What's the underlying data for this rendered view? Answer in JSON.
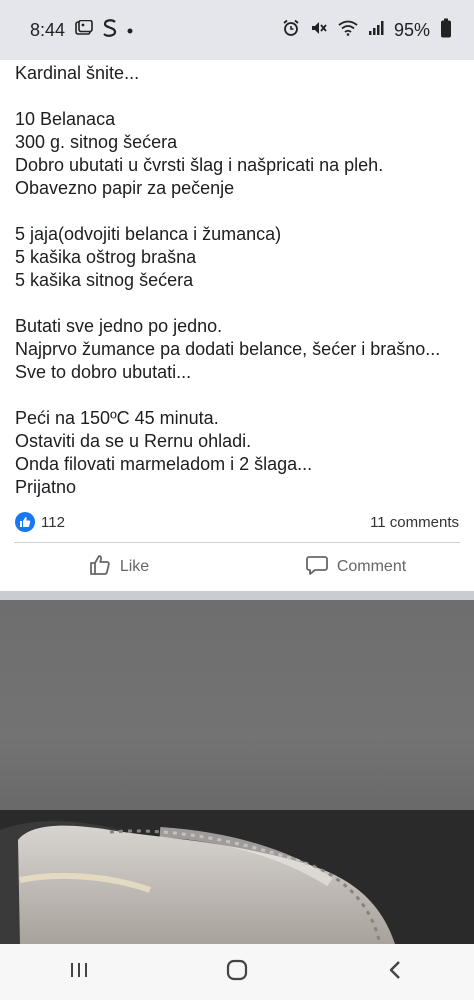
{
  "status_bar": {
    "time": "8:44",
    "battery": "95%",
    "icons": [
      "gallery-icon",
      "s-app-icon",
      "dot-icon",
      "alarm-icon",
      "mute-icon",
      "wifi-icon",
      "signal-icon",
      "battery-icon"
    ]
  },
  "post": {
    "lines": [
      "Kardinal šnite...",
      "",
      "10 Belanaca",
      "300 g. sitnog šećera",
      "Dobro ubutati u čvrsti šlag i našpricati na pleh.",
      "Obavezno papir za pečenje",
      "",
      "5 jaja(odvojiti belanca i žumanca)",
      "5 kašika oštrog brašna",
      "5 kašika sitnog šećera",
      "",
      "Butati sve jedno po jedno.",
      "Najprvo žumance pa dodati belance, šećer i brašno...",
      "Sve to dobro ubutati...",
      "",
      "Peći na 150ºC 45 minuta.",
      "Ostaviti da se u Rernu ohladi.",
      "Onda filovati marmeladom i 2 šlaga...",
      "Prijatno"
    ],
    "reactions_count": "112",
    "comments_count": "11 comments",
    "like_label": "Like",
    "comment_label": "Comment"
  },
  "colors": {
    "status_bar_bg": "#e4e6eb",
    "like_blue": "#1877f2",
    "action_gray": "#65676b"
  }
}
